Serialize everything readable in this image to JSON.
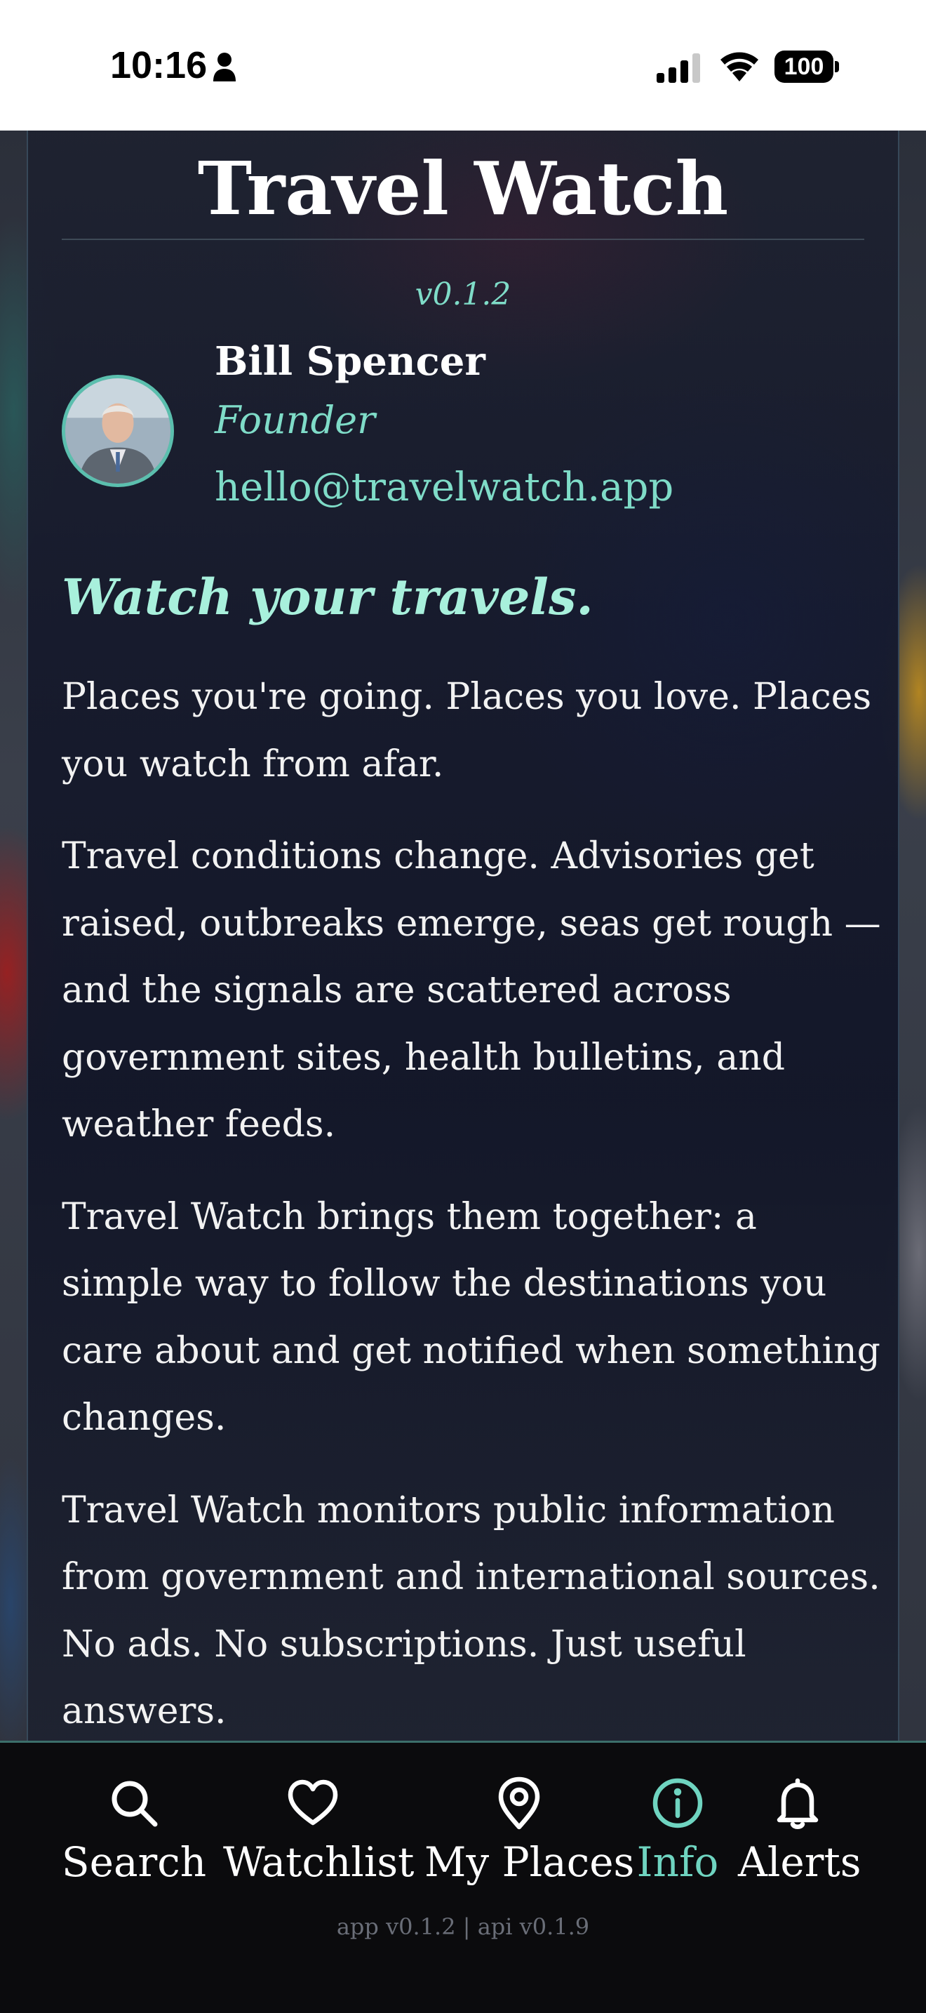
{
  "status_bar": {
    "time": "10:16",
    "battery": "100"
  },
  "app": {
    "title": "Travel Watch",
    "version": "v0.1.2"
  },
  "founder": {
    "name": "Bill Spencer",
    "role": "Founder",
    "email": "hello@travelwatch.app"
  },
  "tagline": "Watch your travels.",
  "paragraphs": [
    "Places you're going. Places you love. Places you watch from afar.",
    "Travel conditions change. Advisories get raised, outbreaks emerge, seas get rough — and the signals are scattered across government sites, health bulletins, and weather feeds.",
    "Travel Watch brings them together: a simple way to follow the destinations you care about and get notified when something changes.",
    "Travel Watch monitors public information from government and international sources. No ads. No subscriptions. Just useful answers."
  ],
  "tabs": [
    {
      "label": "Search",
      "icon": "search-icon",
      "active": false
    },
    {
      "label": "Watchlist",
      "icon": "heart-icon",
      "active": false
    },
    {
      "label": "My Places",
      "icon": "map-pin-icon",
      "active": false
    },
    {
      "label": "Info",
      "icon": "info-icon",
      "active": true
    },
    {
      "label": "Alerts",
      "icon": "bell-icon",
      "active": false
    }
  ],
  "footer": {
    "versions": "app v0.1.2 | api v0.1.9"
  },
  "colors": {
    "accent": "#7fdcc8",
    "tagline": "#a8f0dc",
    "tab_active": "#6fd4c0",
    "tab_bar_bg": "#0b0b0d"
  }
}
